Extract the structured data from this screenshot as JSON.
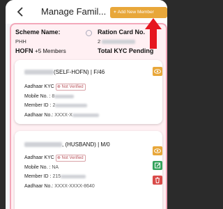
{
  "header": {
    "back_icon": "back-chevron-icon",
    "title": "Manage Famil...",
    "add_button": "Add New Member",
    "accent": "#e8a73a"
  },
  "summary": {
    "scheme_label": "Scheme Name:",
    "scheme_value": "PHH",
    "ration_label": "Ration Card No.",
    "ration_value": "2",
    "hofn_label": "HOFN",
    "hofn_value": "+5 Members",
    "kyc_label": "Total KYC Pending"
  },
  "members": [
    {
      "name_suffix": "(SELF-HOFN) | F/46",
      "aadhaar_kyc_label": "Aadhaar KYC",
      "kyc_status": "Not Verified",
      "mobile_label": "Mobile No. :",
      "mobile_value": "8",
      "member_id_label": "Member ID :",
      "member_id_value": "2",
      "aadhaar_label": "Aadhaar No.:",
      "aadhaar_value": "XXXX-X"
    },
    {
      "name_suffix": ", (HUSBAND) | M/0",
      "aadhaar_kyc_label": "Aadhaar KYC",
      "kyc_status": "Not Verified",
      "mobile_label": "Mobile No. :",
      "mobile_value": "NA",
      "member_id_label": "Member ID :",
      "member_id_value": "215",
      "aadhaar_label": "Aadhaar No.:",
      "aadhaar_value": "XXXX-XXXX-8640"
    }
  ],
  "colors": {
    "eye_button": "#e8a73a",
    "edit_button": "#35a35c",
    "delete_button": "#d94a48",
    "card_border": "#f3a8ba",
    "not_verified": "#b75058"
  }
}
